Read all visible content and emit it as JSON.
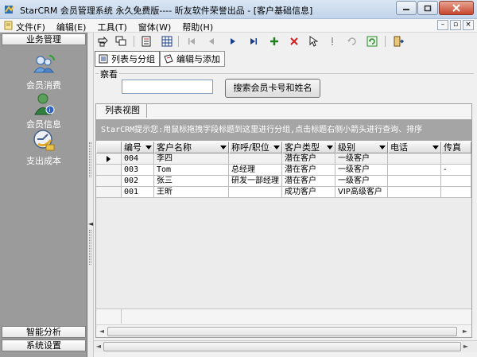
{
  "window": {
    "title": "StarCRM 会员管理系统 永久免费版---- 昕友软件荣誉出品  - [客户基础信息]"
  },
  "menu": {
    "items": [
      "文件(F)",
      "编辑(E)",
      "工具(T)",
      "窗体(W)",
      "帮助(H)"
    ]
  },
  "leftnav": {
    "top_header": "业务管理",
    "entries": [
      {
        "label": "会员消费",
        "icon": "users-refresh-icon"
      },
      {
        "label": "会员信息",
        "icon": "user-info-icon"
      },
      {
        "label": "支出成本",
        "icon": "expense-cost-icon"
      }
    ],
    "bottom_headers": [
      "智能分析",
      "系统设置"
    ]
  },
  "viewtabs": {
    "list_group": "列表与分组",
    "edit_add": "编辑与添加"
  },
  "search": {
    "group_title": "察看",
    "input_value": "",
    "button_label": "搜索会员卡号和姓名"
  },
  "grid": {
    "tab_label": "列表视图",
    "hint": "StarCRM提示您:用鼠标拖拽字段标题到这里进行分组,点击标题右侧小箭头进行查询、排序",
    "columns": [
      "编号",
      "客户名称",
      "称呼/职位",
      "客户类型",
      "级别",
      "电话",
      "传真"
    ],
    "rows": [
      {
        "id": "004",
        "name": "李四",
        "title": "",
        "type": "潜在客户",
        "level": "一级客户",
        "phone": "",
        "fax": ""
      },
      {
        "id": "003",
        "name": "Tom",
        "title": "总经理",
        "type": "潜在客户",
        "level": "一级客户",
        "phone": "",
        "fax": "-"
      },
      {
        "id": "002",
        "name": "张三",
        "title": "研发一部经理",
        "type": "潜在客户",
        "level": "一级客户",
        "phone": "",
        "fax": ""
      },
      {
        "id": "001",
        "name": "王昕",
        "title": "",
        "type": "成功客户",
        "level": "VIP高级客户",
        "phone": "",
        "fax": ""
      }
    ],
    "selected_row": 0
  },
  "colors": {
    "nav_bg": "#9b9b9b",
    "hint_bg": "#a5a5a5",
    "title_grad_top": "#dbe6f3"
  }
}
